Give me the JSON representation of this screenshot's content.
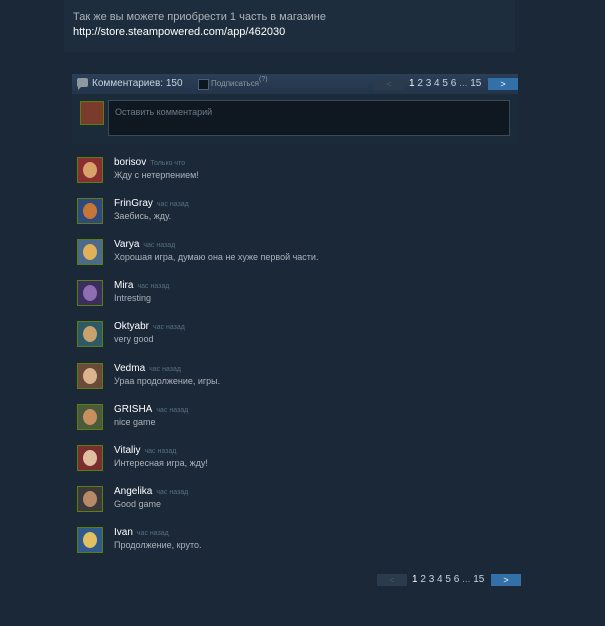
{
  "announcement": {
    "text": "Так же вы можете приобрести 1 часть в магазине ",
    "url": "http://store.steampowered.com/app/462030"
  },
  "comments_header": {
    "count_label": "Комментариев: 150",
    "subscribe_label": "Подписаться",
    "subscribe_help": "(?)"
  },
  "pagination": {
    "prev_label": "<",
    "pages": [
      "1",
      "2",
      "3",
      "4",
      "5",
      "6"
    ],
    "ellipsis": "...",
    "last_page": "15",
    "next_label": ">"
  },
  "comment_form": {
    "placeholder": "Оставить комментарий"
  },
  "comments": [
    {
      "author": "borisov",
      "time": "Только что",
      "text": "Жду с нетерпением!",
      "avatar_color": "#8a2f2f",
      "face_color": "#d7a36b"
    },
    {
      "author": "FrinGray",
      "time": "час назад",
      "text": "Заебись, жду.",
      "avatar_color": "#2f4a7a",
      "face_color": "#c7763a"
    },
    {
      "author": "Varya",
      "time": "час назад",
      "text": "Хорошая игра, думаю она не хуже первой части.",
      "avatar_color": "#4c6b8a",
      "face_color": "#e0b05a"
    },
    {
      "author": "Mira",
      "time": "час назад",
      "text": "Intresting",
      "avatar_color": "#3a2e5c",
      "face_color": "#8e6db3"
    },
    {
      "author": "Oktyabr",
      "time": "час назад",
      "text": "very good",
      "avatar_color": "#2e5a66",
      "face_color": "#c9a16d"
    },
    {
      "author": "Vedma",
      "time": "час назад",
      "text": "Ураа продолжение, игры.",
      "avatar_color": "#6b4a3a",
      "face_color": "#d9b48c"
    },
    {
      "author": "GRISHA",
      "time": "час назад",
      "text": "nice game",
      "avatar_color": "#4a5a3a",
      "face_color": "#c89060"
    },
    {
      "author": "Vitaliy",
      "time": "час назад",
      "text": "Интересная игра, жду!",
      "avatar_color": "#7a2f2f",
      "face_color": "#e0c0a0"
    },
    {
      "author": "Angelika",
      "time": "час назад",
      "text": "Good game",
      "avatar_color": "#3a3a3a",
      "face_color": "#b88a6a"
    },
    {
      "author": "Ivan",
      "time": "час назад",
      "text": "Продолжение, круто.",
      "avatar_color": "#2f5a8a",
      "face_color": "#e0c060"
    }
  ]
}
